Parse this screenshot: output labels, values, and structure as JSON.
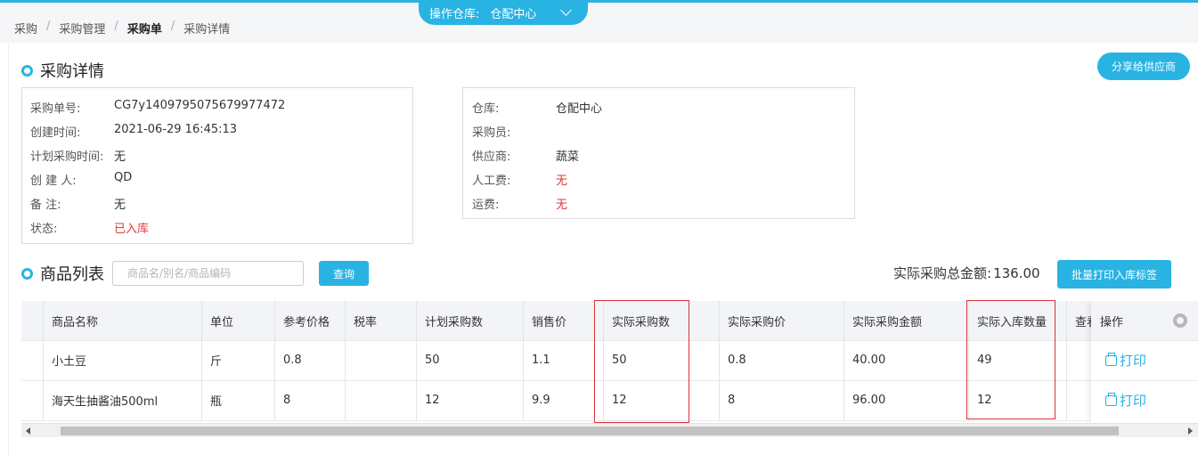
{
  "topbar": {
    "warehouse_label": "操作仓库:",
    "warehouse_value": "仓配中心"
  },
  "breadcrumb": [
    "采购",
    "采购管理",
    "采购单",
    "采购详情"
  ],
  "detail": {
    "title": "采购详情",
    "share_button": "分享给供应商",
    "left": [
      {
        "label": "采购单号:",
        "value": "CG7y1409795075679977472"
      },
      {
        "label": "创建时间:",
        "value": "2021-06-29 16:45:13"
      },
      {
        "label": "计划采购时间:",
        "value": "无"
      },
      {
        "label": "创 建 人:",
        "value": "QD"
      },
      {
        "label": "备 注:",
        "value": "无"
      },
      {
        "label": "状态:",
        "value": "已入库"
      }
    ],
    "right": [
      {
        "label": "仓库:",
        "value": "仓配中心"
      },
      {
        "label": "采购员:",
        "value": ""
      },
      {
        "label": "供应商:",
        "value": "蔬菜"
      },
      {
        "label": "人工费:",
        "value": "无"
      },
      {
        "label": "运费:",
        "value": "无"
      }
    ]
  },
  "goods": {
    "title": "商品列表",
    "search_placeholder": "商品名/别名/商品编码",
    "query_button": "查询",
    "total_label": "实际采购总金额:",
    "total_value": "136.00",
    "print_all_button": "批量打印入库标签",
    "columns": [
      "商品名称",
      "单位",
      "参考价格",
      "税率",
      "计划采购数",
      "销售价",
      "实际采购数",
      "实际采购价",
      "实际采购金额",
      "实际入库数量",
      "查看",
      "操作"
    ],
    "rows": [
      {
        "name": "小土豆",
        "unit": "斤",
        "ref_price": "0.8",
        "tax": "",
        "plan_qty": "50",
        "sale_price": "1.1",
        "actual_qty": "50",
        "actual_price": "0.8",
        "actual_amount": "40.00",
        "in_qty": "49",
        "action": "打印"
      },
      {
        "name": "海天生抽酱油500ml",
        "unit": "瓶",
        "ref_price": "8",
        "tax": "",
        "plan_qty": "12",
        "sale_price": "9.9",
        "actual_qty": "12",
        "actual_price": "8",
        "actual_amount": "96.00",
        "in_qty": "12",
        "action": "打印"
      }
    ]
  },
  "colors": {
    "accent": "#29b3e3",
    "status_red": "#e23b3b",
    "highlight_box": "#d8343b"
  }
}
